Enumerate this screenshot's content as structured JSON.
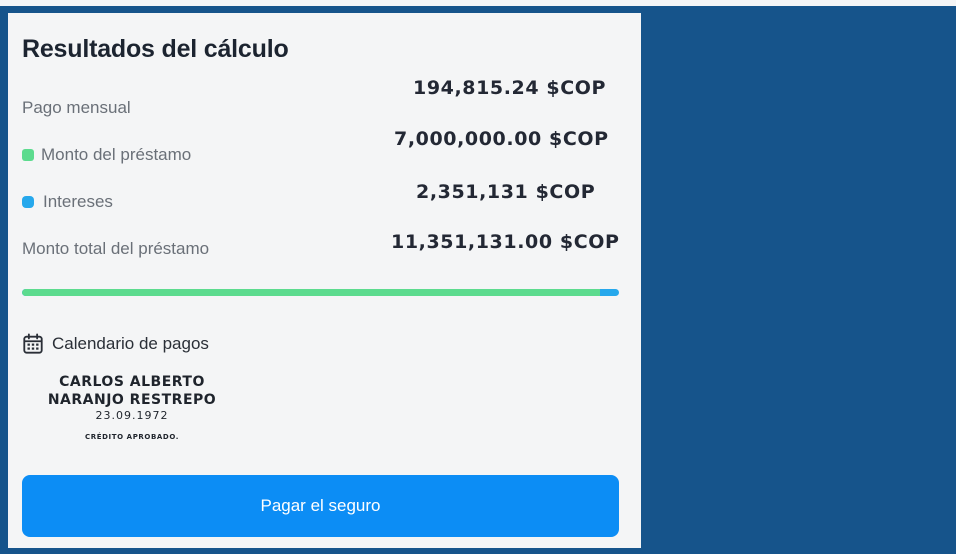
{
  "results": {
    "title": "Resultados del cálculo",
    "monthly_payment": {
      "label": "Pago mensual",
      "value": "194,815.24 $COP"
    },
    "loan_amount": {
      "label": "Monto del préstamo",
      "value": "7,000,000.00 $COP",
      "color": "#5cdb8e"
    },
    "interest": {
      "label": "Intereses",
      "value": "2,351,131 $COP",
      "color": "#26a8ec"
    },
    "total": {
      "label": "Monto total del préstamo",
      "value": "11,351,131.00 $COP"
    },
    "breakdown_bar": {
      "principal_fraction": 0.969,
      "principal_color": "#5cdb8e",
      "interest_color": "#26a8ec"
    }
  },
  "schedule": {
    "icon": "calendar-icon",
    "label": "Calendario de pagos"
  },
  "holder": {
    "name_line1": "CARLOS ALBERTO",
    "name_line2": "NARANJO RESTREPO",
    "date": "23.09.1972",
    "status": "CRÉDITO APROBADO."
  },
  "actions": {
    "pay_button": "Pagar el seguro",
    "accent": "#0c8df5"
  }
}
